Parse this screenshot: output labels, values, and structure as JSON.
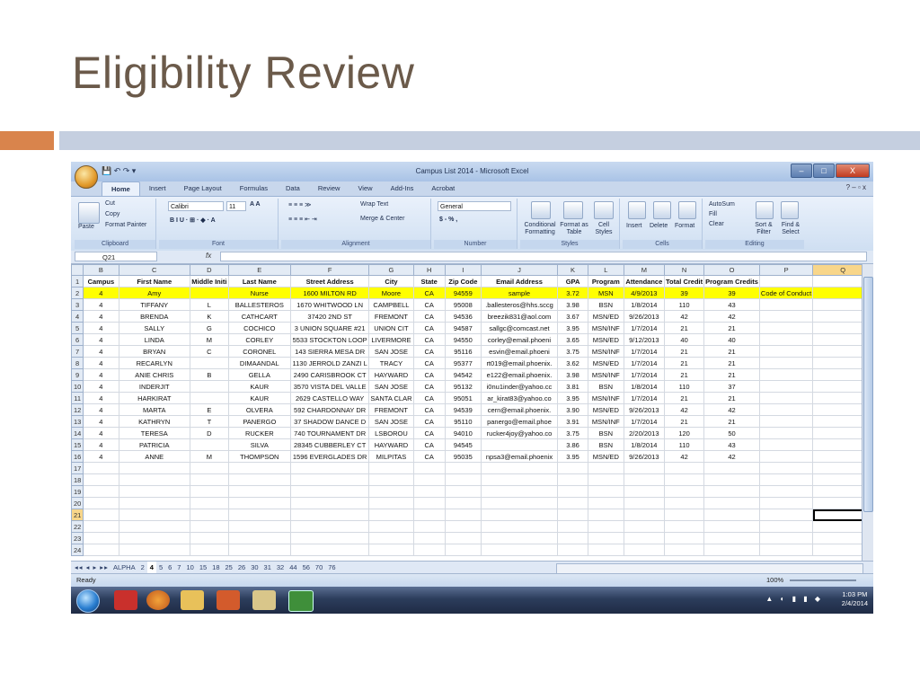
{
  "slide": {
    "title": "Eligibility Review",
    "accent_colors": {
      "orange": "#d9844c",
      "blue": "#c5cfe0"
    }
  },
  "window": {
    "title": "Campus List 2014 - Microsoft Excel",
    "controls": [
      "–",
      "□",
      "X"
    ]
  },
  "ribbon": {
    "tabs": [
      "Home",
      "Insert",
      "Page Layout",
      "Formulas",
      "Data",
      "Review",
      "View",
      "Add-Ins",
      "Acrobat"
    ],
    "active_tab": "Home",
    "clipboard": {
      "paste": "Paste",
      "cut": "Cut",
      "copy": "Copy",
      "format_painter": "Format Painter",
      "label": "Clipboard"
    },
    "font": {
      "name": "Calibri",
      "size": "11",
      "label": "Font"
    },
    "alignment": {
      "wrap_text": "Wrap Text",
      "merge_center": "Merge & Center",
      "label": "Alignment"
    },
    "number": {
      "format": "General",
      "symbols": "$ - % ,",
      "label": "Number"
    },
    "styles": {
      "conditional": "Conditional Formatting",
      "format_table": "Format as Table",
      "cell_styles": "Cell Styles",
      "label": "Styles"
    },
    "cells": {
      "insert": "Insert",
      "delete": "Delete",
      "format": "Format",
      "label": "Cells"
    },
    "editing": {
      "autosum": "AutoSum",
      "fill": "Fill",
      "clear": "Clear",
      "sort_filter": "Sort & Filter",
      "find_select": "Find & Select",
      "label": "Editing"
    }
  },
  "formula_bar": {
    "name_box": "Q21",
    "fx": "fx",
    "value": ""
  },
  "grid": {
    "columns": [
      "B",
      "C",
      "D",
      "E",
      "F",
      "G",
      "H",
      "I",
      "J",
      "K",
      "L",
      "M",
      "N",
      "O",
      "P",
      "Q"
    ],
    "selected_column": "Q",
    "selected_row": "21",
    "headers": [
      "Campus",
      "First Name",
      "Middle Initi",
      "Last Name",
      "Street Address",
      "City",
      "State",
      "Zip Code",
      "Email Address",
      "GPA",
      "Program",
      "Attendance",
      "Total Credit",
      "Program Credits",
      "",
      ""
    ],
    "rows": [
      [
        "4",
        "Amy",
        "",
        "Nurse",
        "1600 MILTON RD",
        "Moore",
        "CA",
        "94559",
        "sample",
        "3.72",
        "MSN",
        "4/9/2013",
        "39",
        "39",
        "Code of Conduct",
        ""
      ],
      [
        "4",
        "TIFFANY",
        "L",
        "BALLESTEROS",
        "1670 WHITWOOD LN",
        "CAMPBELL",
        "CA",
        "95008",
        ".ballesteros@hhs.sccg",
        "3.98",
        "BSN",
        "1/8/2014",
        "110",
        "43",
        "",
        ""
      ],
      [
        "4",
        "BRENDA",
        "K",
        "CATHCART",
        "37420 2ND ST",
        "FREMONT",
        "CA",
        "94536",
        "breezik831@aol.com",
        "3.67",
        "MSN/ED",
        "9/26/2013",
        "42",
        "42",
        "",
        ""
      ],
      [
        "4",
        "SALLY",
        "G",
        "COCHICO",
        "3 UNION SQUARE #21",
        "UNION CIT",
        "CA",
        "94587",
        "sallgc@comcast.net",
        "3.95",
        "MSN/INF",
        "1/7/2014",
        "21",
        "21",
        "",
        ""
      ],
      [
        "4",
        "LINDA",
        "M",
        "CORLEY",
        "5533 STOCKTON LOOP",
        "LIVERMORE",
        "CA",
        "94550",
        "corley@email.phoeni",
        "3.65",
        "MSN/ED",
        "9/12/2013",
        "40",
        "40",
        "",
        ""
      ],
      [
        "4",
        "BRYAN",
        "C",
        "CORONEL",
        "143 SIERRA MESA DR",
        "SAN JOSE",
        "CA",
        "95116",
        "esvin@email.phoeni",
        "3.75",
        "MSN/INF",
        "1/7/2014",
        "21",
        "21",
        "",
        ""
      ],
      [
        "4",
        "RECARLYN",
        "",
        "DIMAANDAL",
        "1130 JERROLD ZANZI L",
        "TRACY",
        "CA",
        "95377",
        "rt019@email.phoenix.",
        "3.62",
        "MSN/ED",
        "1/7/2014",
        "21",
        "21",
        "",
        ""
      ],
      [
        "4",
        "ANIE CHRIS",
        "B",
        "GELLA",
        "2490 CARISBROOK CT",
        "HAYWARD",
        "CA",
        "94542",
        "e122@email.phoenix.",
        "3.98",
        "MSN/INF",
        "1/7/2014",
        "21",
        "21",
        "",
        ""
      ],
      [
        "4",
        "INDERJIT",
        "",
        "KAUR",
        "3570 VISTA DEL VALLE",
        "SAN JOSE",
        "CA",
        "95132",
        "i0nu1inder@yahoo.cc",
        "3.81",
        "BSN",
        "1/8/2014",
        "110",
        "37",
        "",
        ""
      ],
      [
        "4",
        "HARKIRAT",
        "",
        "KAUR",
        "2629 CASTELLO WAY",
        "SANTA CLAR",
        "CA",
        "95051",
        "ar_kirat83@yahoo.co",
        "3.95",
        "MSN/INF",
        "1/7/2014",
        "21",
        "21",
        "",
        ""
      ],
      [
        "4",
        "MARTA",
        "E",
        "OLVERA",
        "592 CHARDONNAY DR",
        "FREMONT",
        "CA",
        "94539",
        "cern@email.phoenix.",
        "3.90",
        "MSN/ED",
        "9/26/2013",
        "42",
        "42",
        "",
        ""
      ],
      [
        "4",
        "KATHRYN",
        "T",
        "PANERGO",
        "37 SHADOW DANCE D",
        "SAN JOSE",
        "CA",
        "95110",
        "panergo@email.phoe",
        "3.91",
        "MSN/INF",
        "1/7/2014",
        "21",
        "21",
        "",
        ""
      ],
      [
        "4",
        "TERESA",
        "D",
        "RUCKER",
        "740 TOURNAMENT DR",
        "LSBOROU",
        "CA",
        "94010",
        "rucker4joy@yahoo.co",
        "3.75",
        "BSN",
        "2/20/2013",
        "120",
        "50",
        "",
        ""
      ],
      [
        "4",
        "PATRICIA",
        "",
        "SILVA",
        "28345 CUBBERLEY CT",
        "HAYWARD",
        "CA",
        "94545",
        "",
        "3.86",
        "BSN",
        "1/8/2014",
        "110",
        "43",
        "",
        ""
      ],
      [
        "4",
        "ANNE",
        "M",
        "THOMPSON",
        "1596 EVERGLADES DR",
        "MILPITAS",
        "CA",
        "95035",
        "npsa3@email.phoenix",
        "3.95",
        "MSN/ED",
        "9/26/2013",
        "42",
        "42",
        "",
        ""
      ]
    ],
    "empty_rows": [
      "17",
      "18",
      "19",
      "20",
      "21",
      "22",
      "23",
      "24"
    ],
    "highlight_color": "#ffff00"
  },
  "sheet_tabs": {
    "nav": "◂◂ ◂ ▸ ▸▸",
    "tabs": [
      "ALPHA",
      "2",
      "4",
      "5",
      "6",
      "7",
      "10",
      "15",
      "18",
      "25",
      "26",
      "30",
      "31",
      "32",
      "44",
      "56",
      "70",
      "76"
    ],
    "active": "4"
  },
  "status": {
    "ready": "Ready",
    "zoom": "100%"
  },
  "taskbar": {
    "time": "1:03 PM",
    "date": "2/4/2014"
  }
}
